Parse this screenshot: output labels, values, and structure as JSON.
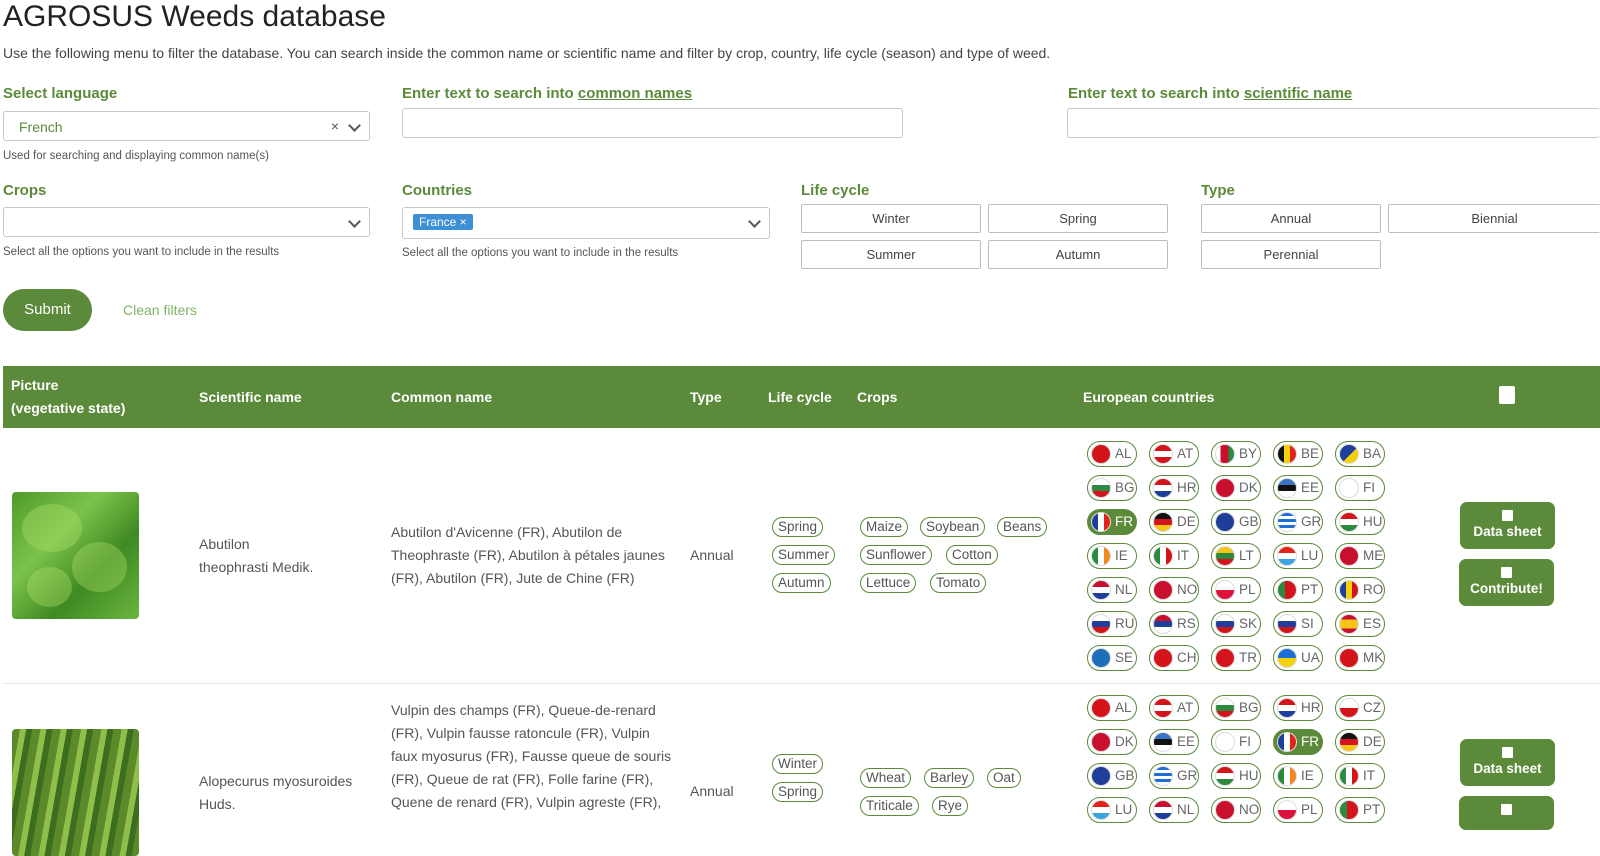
{
  "title": "AGROSUS Weeds database",
  "intro": "Use the following menu to filter the database. You can search inside the common name or scientific name and filter by crop, country, life cycle (season) and type of weed.",
  "filters": {
    "language_label": "Select language",
    "language_value": "French",
    "language_hint": "Used for searching and displaying common name(s)",
    "common_label_prefix": "Enter text to search into ",
    "common_label_link": "common names",
    "common_value": "",
    "scientific_label_prefix": "Enter text to search into ",
    "scientific_label_link": "scientific name",
    "scientific_value": "",
    "crops_label": "Crops",
    "crops_hint": "Select all the options you want to include in the results",
    "countries_label": "Countries",
    "countries_tag": "France ×",
    "countries_hint": "Select all the options you want to include in the results",
    "lifecycle_label": "Life cycle",
    "lifecycle_options": [
      "Winter",
      "Spring",
      "Summer",
      "Autumn"
    ],
    "type_label": "Type",
    "type_options": [
      "Annual",
      "Biennial",
      "Perennial"
    ],
    "submit": "Submit",
    "clean": "Clean filters",
    "clear_icon": "×"
  },
  "table": {
    "headers": [
      "Picture",
      "(vegetative state)",
      "Scientific name",
      "Common name",
      "Type",
      "Life cycle",
      "Crops",
      "European countries"
    ],
    "actions": {
      "datasheet": "Data sheet",
      "contribute": "Contribute!"
    },
    "rows": [
      {
        "scientific": [
          "Abutilon",
          "theophrasti Medik."
        ],
        "common": [
          "Abutilon d'Avicenne (FR), Abutilon de",
          "Theophraste (FR), Abutilon à pétales jaunes",
          "(FR), Abutilon (FR), Jute de Chine (FR)"
        ],
        "type": "Annual",
        "lifecycle": [
          "Spring",
          "Summer",
          "Autumn"
        ],
        "crops": [
          "Maize",
          "Soybean",
          "Beans",
          "Sunflower",
          "Cotton",
          "Lettuce",
          "Tomato"
        ],
        "countries": [
          "AL",
          "AT",
          "BY",
          "BE",
          "BA",
          "BG",
          "HR",
          "DK",
          "EE",
          "FI",
          "FR",
          "DE",
          "GB",
          "GR",
          "HU",
          "IE",
          "IT",
          "LT",
          "LU",
          "ME",
          "NL",
          "NO",
          "PL",
          "PT",
          "RO",
          "RU",
          "RS",
          "SK",
          "SI",
          "ES",
          "SE",
          "CH",
          "TR",
          "UA",
          "MK"
        ],
        "selected_country": "FR"
      },
      {
        "scientific": [
          "Alopecurus myosuroides",
          "Huds."
        ],
        "common": [
          "Vulpin des champs (FR), Queue-de-renard",
          "(FR), Vulpin fausse ratoncule (FR), Vulpin",
          "faux myosurus (FR), Fausse queue de souris",
          "(FR), Queue de rat (FR), Folle farine (FR),",
          "Quene de renard (FR), Vulpin agreste (FR),"
        ],
        "type": "Annual",
        "lifecycle": [
          "Winter",
          "Spring"
        ],
        "crops": [
          "Wheat",
          "Barley",
          "Oat",
          "Triticale",
          "Rye"
        ],
        "countries": [
          "AL",
          "AT",
          "BG",
          "HR",
          "CZ",
          "DK",
          "EE",
          "FI",
          "FR",
          "DE",
          "GB",
          "GR",
          "HU",
          "IE",
          "IT",
          "LU",
          "NL",
          "NO",
          "PL",
          "PT"
        ],
        "selected_country": "FR"
      }
    ]
  },
  "colors": {
    "accent": "#5b8a3a",
    "tag": "#3d8fd6",
    "link_light": "#7db56b"
  },
  "icons": [
    "chevron-down-icon",
    "clear-icon",
    "book-icon",
    "comment-icon",
    "flag-icons"
  ]
}
